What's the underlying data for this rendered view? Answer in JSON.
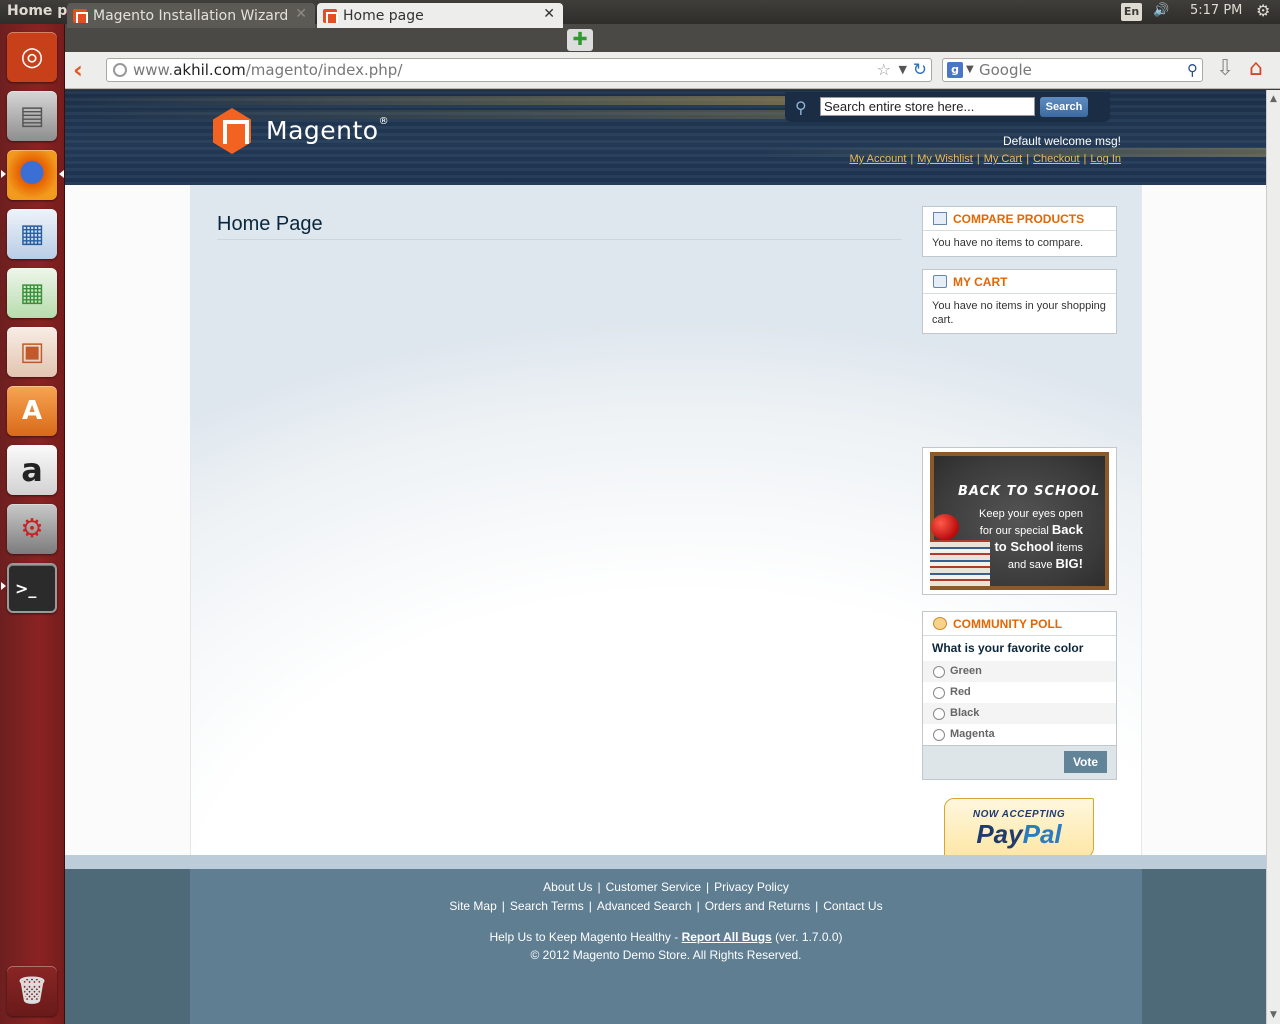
{
  "os": {
    "window_title": "Home page - Mozilla Firefox",
    "keyboard": "En",
    "clock": "5:17 PM",
    "launcher": [
      {
        "name": "ubuntu-dash-icon",
        "glyph": "◎",
        "color": "#dd4814"
      },
      {
        "name": "files-icon",
        "glyph": "▤",
        "color": "#9b9b9b"
      },
      {
        "name": "firefox-icon",
        "glyph": "◉",
        "color": "#e66000"
      },
      {
        "name": "writer-icon",
        "glyph": "▦",
        "color": "#2a5d9f"
      },
      {
        "name": "calc-icon",
        "glyph": "▦",
        "color": "#3b8f3b"
      },
      {
        "name": "impress-icon",
        "glyph": "▣",
        "color": "#c05a2a"
      },
      {
        "name": "software-center-icon",
        "glyph": "A",
        "color": "#e07a2a"
      },
      {
        "name": "amazon-icon",
        "glyph": "a",
        "color": "#f0f0f0"
      },
      {
        "name": "system-settings-icon",
        "glyph": "⚙",
        "color": "#8a8a8a"
      },
      {
        "name": "terminal-icon",
        "glyph": ">_",
        "color": "#2b2b2b"
      },
      {
        "name": "trash-icon",
        "glyph": "🗑",
        "color": "#c8c8c8"
      }
    ]
  },
  "browser": {
    "tabs": [
      {
        "label": "Magento Installation Wizard"
      },
      {
        "label": "Home page"
      }
    ],
    "url_prefix": "www.",
    "url_host": "akhil.com",
    "url_path": "/magento/index.php/",
    "search_placeholder": "Google"
  },
  "store": {
    "logo_text": "Magento",
    "search_placeholder": "Search entire store here...",
    "search_button": "Search",
    "welcome": "Default welcome msg!",
    "toplinks": [
      "My Account",
      "My Wishlist",
      "My Cart",
      "Checkout",
      "Log In"
    ],
    "page_title": "Home Page",
    "compare": {
      "title": "COMPARE PRODUCTS",
      "text": "You have no items to compare."
    },
    "cart": {
      "title": "MY CART",
      "text": "You have no items in your shopping cart."
    },
    "promo": {
      "title": "BACK TO SCHOOL",
      "line1": "Keep your eyes open",
      "line2": "for our special",
      "bold1": "Back",
      "bold2": "to School",
      "line3": "items",
      "line4": "and save",
      "bold3": "BIG!"
    },
    "poll": {
      "title": "COMMUNITY POLL",
      "question": "What is your favorite color",
      "options": [
        "Green",
        "Red",
        "Black",
        "Magenta"
      ],
      "vote": "Vote"
    },
    "paypal": {
      "now": "NOW ACCEPTING",
      "pay": "Pay",
      "pal": "Pal"
    },
    "footer": {
      "links1": [
        "About Us",
        "Customer Service",
        "Privacy Policy"
      ],
      "links2": [
        "Site Map",
        "Search Terms",
        "Advanced Search",
        "Orders and Returns",
        "Contact Us"
      ],
      "help_prefix": "Help Us to Keep Magento Healthy -",
      "report": "Report All Bugs",
      "version": "(ver. 1.7.0.0)",
      "copyright": "© 2012 Magento Demo Store. All Rights Reserved."
    }
  }
}
